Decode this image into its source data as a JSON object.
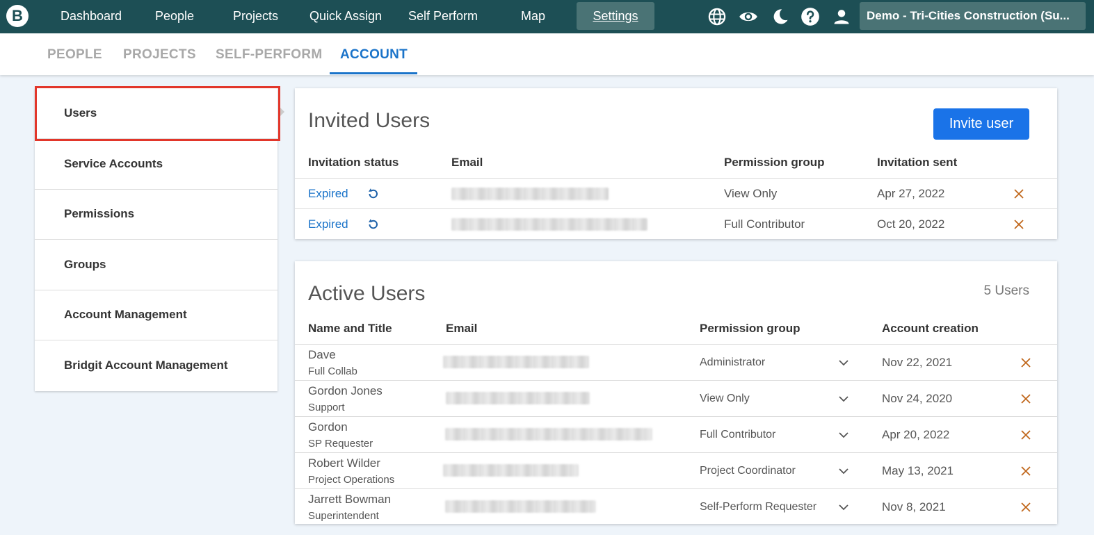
{
  "topbar": {
    "logo": "B",
    "nav": [
      "Dashboard",
      "People",
      "Projects",
      "Quick Assign",
      "Self Perform",
      "Map"
    ],
    "active": "Settings",
    "account": "Demo - Tri-Cities Construction (Su..."
  },
  "subtabs": [
    "PEOPLE",
    "PROJECTS",
    "SELF-PERFORM",
    "ACCOUNT"
  ],
  "menu": [
    "Users",
    "Service Accounts",
    "Permissions",
    "Groups",
    "Account Management",
    "Bridgit Account Management"
  ],
  "invited": {
    "title": "Invited Users",
    "invite_button": "Invite user",
    "headers": [
      "Invitation status",
      "Email",
      "Permission group",
      "Invitation sent"
    ],
    "rows": [
      {
        "status": "Expired",
        "permission": "View Only",
        "sent": "Apr 27, 2022"
      },
      {
        "status": "Expired",
        "permission": "Full Contributor",
        "sent": "Oct 20, 2022"
      }
    ]
  },
  "active": {
    "title": "Active Users",
    "count": "5 Users",
    "headers": [
      "Name and Title",
      "Email",
      "Permission group",
      "Account creation"
    ],
    "rows": [
      {
        "name": "Dave",
        "title": "Full Collab",
        "permission": "Administrator",
        "created": "Nov 22, 2021"
      },
      {
        "name": "Gordon Jones",
        "title": "Support",
        "permission": "View Only",
        "created": "Nov 24, 2020"
      },
      {
        "name": "Gordon",
        "title": "SP Requester",
        "permission": "Full Contributor",
        "created": "Apr 20, 2022"
      },
      {
        "name": "Robert Wilder",
        "title": "Project Operations",
        "permission": "Project Coordinator",
        "created": "May 13, 2021"
      },
      {
        "name": "Jarrett Bowman",
        "title": "Superintendent",
        "permission": "Self-Perform Requester",
        "created": "Nov 8, 2021"
      }
    ]
  },
  "colors": {
    "topbar": "#1d4f55",
    "accent": "#1a73c9",
    "delete": "#c0661a",
    "highlight": "#e2362a"
  },
  "icons": {
    "top": [
      "globe-icon",
      "eye-icon",
      "moon-icon",
      "help-icon",
      "user-icon"
    ],
    "resend": "refresh-icon",
    "delete": "close-icon",
    "dropdown": "chevron-down-icon"
  }
}
